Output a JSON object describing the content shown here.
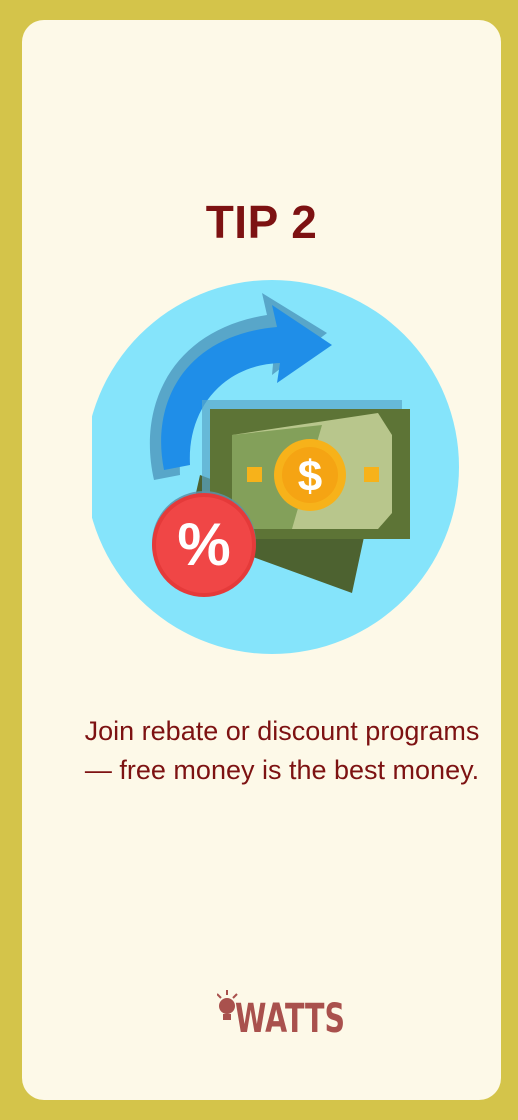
{
  "card": {
    "title": "TIP 2",
    "body": "Join rebate or discount programs — free money is the best money."
  },
  "illustration": {
    "currency_symbol": "$",
    "discount_symbol": "%"
  },
  "logo": {
    "text": "WATTS",
    "icon": "lightbulb-icon"
  },
  "colors": {
    "background": "#d4c44a",
    "card": "#fdf9e8",
    "text": "#7d1212",
    "circle": "#85e4fb",
    "arrow": "#1489e6",
    "bill": "#5b7336",
    "coin": "#f7b21a",
    "badge": "#e53a3a",
    "logo": "#a9514d"
  }
}
